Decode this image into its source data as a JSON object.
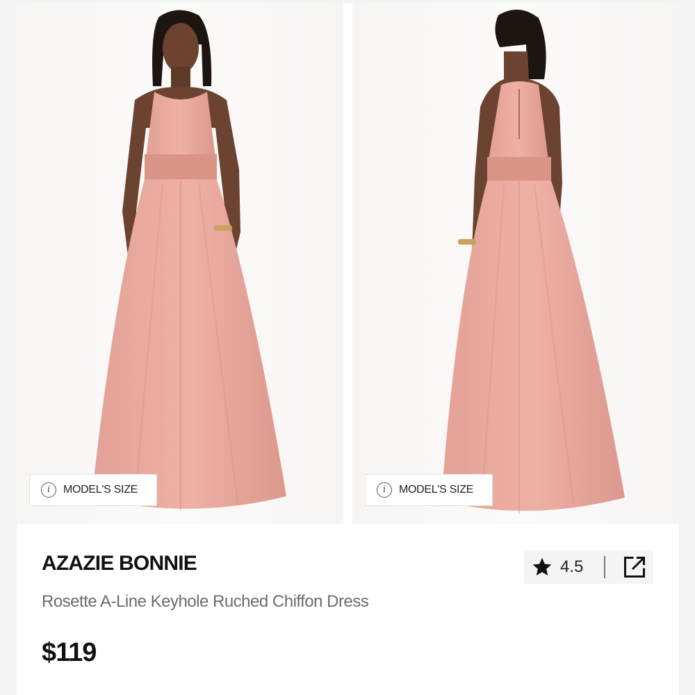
{
  "product": {
    "brand": "AZAZIE BONNIE",
    "name": "Rosette A-Line Keyhole Ruched Chiffon Dress",
    "price": "$119",
    "rating": "4.5"
  },
  "images": [
    {
      "view": "front",
      "model_size_label": "MODEL'S SIZE",
      "icon": "info-icon"
    },
    {
      "view": "back",
      "model_size_label": "MODEL'S SIZE",
      "icon": "info-icon"
    }
  ],
  "icons": {
    "rating": "star-icon",
    "share": "share-icon"
  },
  "colors": {
    "dress": "#e7a79c",
    "skin": "#6b4330",
    "hair": "#1c1512",
    "text_primary": "#111111",
    "text_secondary": "#6b6b6b"
  }
}
